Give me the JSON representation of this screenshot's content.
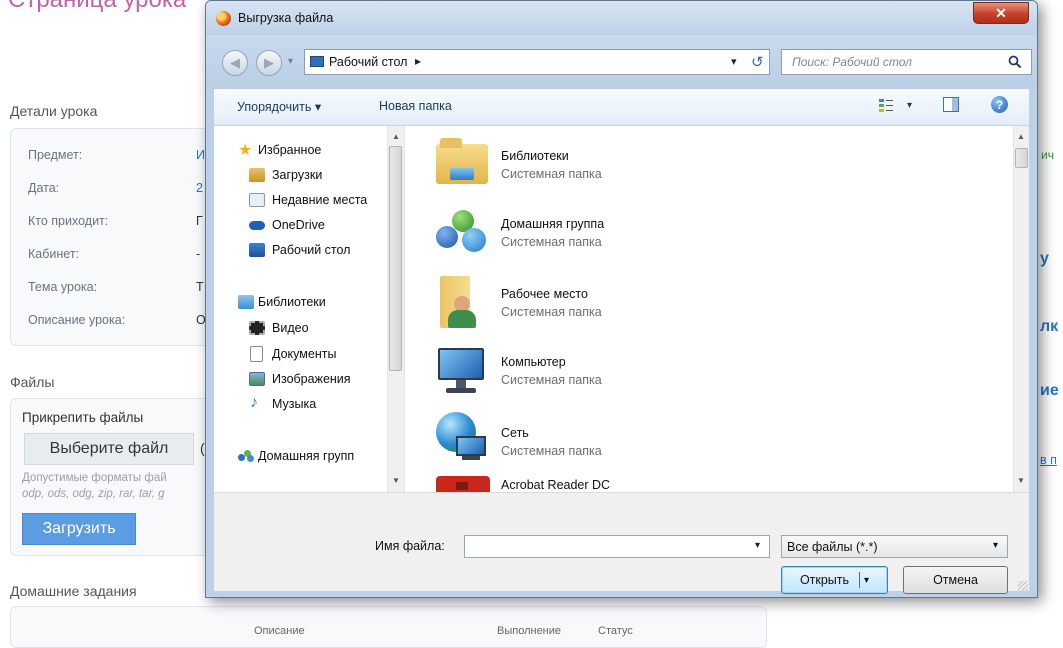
{
  "page": {
    "title": "Страница урока",
    "details_heading": "Детали урока",
    "fields": [
      {
        "label": "Предмет:",
        "value": "И"
      },
      {
        "label": "Дата:",
        "value": "2"
      },
      {
        "label": "Кто приходит:",
        "value": "Г"
      },
      {
        "label": "Кабинет:",
        "value": "-"
      },
      {
        "label": "Тема урока:",
        "value": "Т"
      },
      {
        "label": "Описание урока:",
        "value": "О"
      }
    ],
    "files_heading": "Файлы",
    "attach_label": "Прикрепить файлы",
    "choose_file": "Выберите файл",
    "choose_file_tail": "(",
    "formats_line1": "Допустимые форматы фай",
    "formats_line2": "odp, ods, odg, zip, rar, tar, g",
    "upload": "Загрузить",
    "homework_heading": "Домашние задания",
    "table_headers": [
      "Описание",
      "Выполнение",
      "Статус"
    ],
    "right_fragments": [
      "ич",
      "у",
      "лк",
      "ие",
      "в п"
    ]
  },
  "dialog": {
    "title": "Выгрузка файла",
    "close_symbol": "✕",
    "back_symbol": "◀",
    "forward_symbol": "▶",
    "history_arrow": "▾",
    "address": "Рабочий стол",
    "address_arrow": "▸",
    "address_dropdown": "▾",
    "refresh_symbol": "↺",
    "search_placeholder": "Поиск: Рабочий стол",
    "toolbar": {
      "organize": "Упорядочить ▾",
      "new_folder": "Новая папка",
      "view_arrow": "▾",
      "help": "?"
    },
    "nav": [
      {
        "label": "Избранное",
        "icon": "star-icon"
      },
      {
        "label": "Загрузки",
        "icon": "downloads-icon"
      },
      {
        "label": "Недавние места",
        "icon": "recent-places-icon"
      },
      {
        "label": "OneDrive",
        "icon": "onedrive-icon"
      },
      {
        "label": "Рабочий стол",
        "icon": "desktop-icon"
      },
      {
        "label": "Библиотеки",
        "icon": "libraries-icon"
      },
      {
        "label": "Видео",
        "icon": "video-icon"
      },
      {
        "label": "Документы",
        "icon": "documents-icon"
      },
      {
        "label": "Изображения",
        "icon": "images-icon"
      },
      {
        "label": "Музыка",
        "icon": "music-icon"
      },
      {
        "label": "Домашняя групп",
        "icon": "homegroup-icon"
      }
    ],
    "files": [
      {
        "name": "Библиотеки",
        "type": "Системная папка",
        "icon": "libraries-folder-icon"
      },
      {
        "name": "Домашняя группа",
        "type": "Системная папка",
        "icon": "homegroup-icon"
      },
      {
        "name": "Рабочее место",
        "type": "Системная папка",
        "icon": "user-folder-icon"
      },
      {
        "name": "Компьютер",
        "type": "Системная папка",
        "icon": "computer-icon"
      },
      {
        "name": "Сеть",
        "type": "Системная папка",
        "icon": "network-icon"
      },
      {
        "name": "Acrobat Reader DC",
        "type": "",
        "icon": "acrobat-icon"
      }
    ],
    "filename_label": "Имя файла:",
    "filename_value": "",
    "filetype": "Все файлы (*.*)",
    "open": "Открыть",
    "open_arrow": "▾",
    "cancel": "Отмена",
    "scroll_up": "▲",
    "scroll_down": "▼"
  }
}
